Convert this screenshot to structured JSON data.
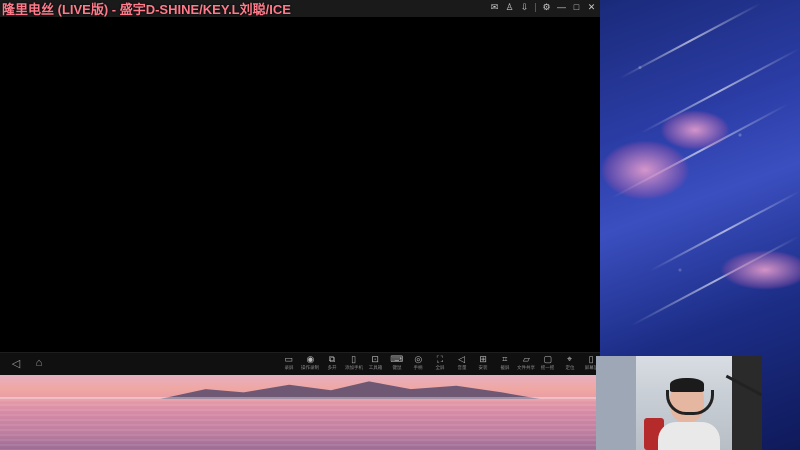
{
  "window": {
    "title": "隆里电丝 (LIVE版) - 盛宇D-SHINE/KEY.L刘聪/ICE",
    "controls": [
      {
        "name": "mail-icon",
        "glyph": "✉"
      },
      {
        "name": "user-icon",
        "glyph": "♙"
      },
      {
        "name": "download-icon",
        "glyph": "⇩"
      },
      {
        "name": "settings-icon",
        "glyph": "⚙"
      },
      {
        "name": "minimize-icon",
        "glyph": "—"
      },
      {
        "name": "maximize-icon",
        "glyph": "□"
      },
      {
        "name": "close-icon",
        "glyph": "✕"
      }
    ]
  },
  "nav": {
    "back_glyph": "◁",
    "home_glyph": "⌂"
  },
  "toolbar": {
    "tools": [
      {
        "name": "record-tool",
        "icon": "▭",
        "label": "录屏"
      },
      {
        "name": "operation-record-tool",
        "icon": "◉",
        "label": "操作录制"
      },
      {
        "name": "multi-open-tool",
        "icon": "⧉",
        "label": "多开"
      },
      {
        "name": "add-phone-tool",
        "icon": "▯",
        "label": "添加手机"
      },
      {
        "name": "toolbox-tool",
        "icon": "⊡",
        "label": "工具箱"
      },
      {
        "name": "keyboard-tool",
        "icon": "⌨",
        "label": "键鼠"
      },
      {
        "name": "gamepad-tool",
        "icon": "◎",
        "label": "手柄"
      },
      {
        "name": "fullscreen-tool",
        "icon": "⛶",
        "label": "全屏"
      },
      {
        "name": "volume-tool",
        "icon": "◁",
        "label": "音量"
      },
      {
        "name": "install-tool",
        "icon": "⊞",
        "label": "安装"
      },
      {
        "name": "screenshot-tool",
        "icon": "⌗",
        "label": "截屏"
      },
      {
        "name": "file-share-tool",
        "icon": "▱",
        "label": "文件共享"
      },
      {
        "name": "shake-tool",
        "icon": "▢",
        "label": "摇一摇"
      },
      {
        "name": "location-tool",
        "icon": "⌖",
        "label": "定位"
      },
      {
        "name": "rotate-tool",
        "icon": "▯",
        "label": "屏幕旋"
      }
    ]
  }
}
